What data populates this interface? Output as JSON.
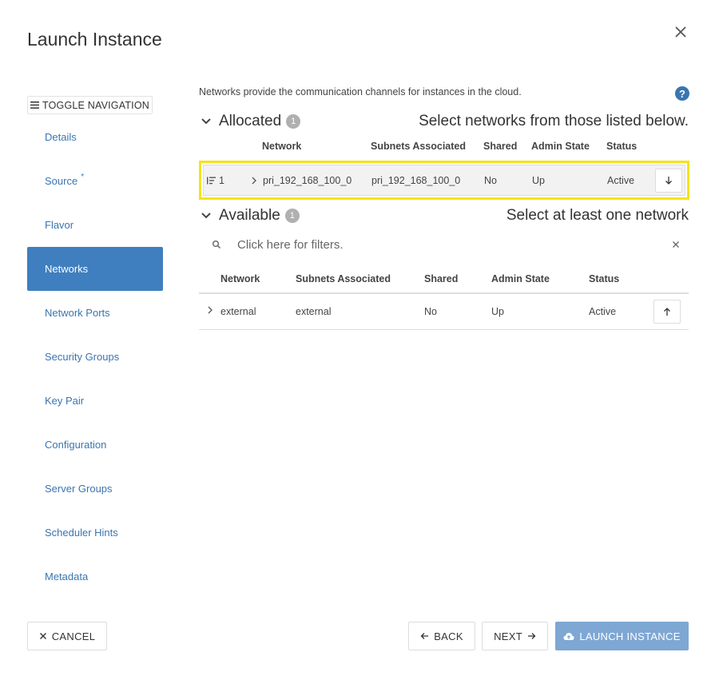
{
  "dialog": {
    "title": "Launch Instance",
    "close_icon": "close-icon"
  },
  "sidebar": {
    "toggle_label": "TOGGLE NAVIGATION",
    "items": [
      {
        "label": "Details",
        "active": false
      },
      {
        "label": "Source",
        "required_mark": "*",
        "active": false
      },
      {
        "label": "Flavor",
        "active": false
      },
      {
        "label": "Networks",
        "active": true
      },
      {
        "label": "Network Ports",
        "active": false
      },
      {
        "label": "Security Groups",
        "active": false
      },
      {
        "label": "Key Pair",
        "active": false
      },
      {
        "label": "Configuration",
        "active": false
      },
      {
        "label": "Server Groups",
        "active": false
      },
      {
        "label": "Scheduler Hints",
        "active": false
      },
      {
        "label": "Metadata",
        "active": false
      }
    ]
  },
  "main": {
    "description": "Networks provide the communication channels for instances in the cloud.",
    "help_label": "?",
    "allocated": {
      "title": "Allocated",
      "count": "1",
      "hint": "Select networks from those listed below.",
      "columns": [
        "Network",
        "Subnets Associated",
        "Shared",
        "Admin State",
        "Status"
      ],
      "rows": [
        {
          "order": "1",
          "network": "pri_192_168_100_0",
          "subnets": "pri_192_168_100_0",
          "shared": "No",
          "admin_state": "Up",
          "status": "Active"
        }
      ]
    },
    "available": {
      "title": "Available",
      "count": "1",
      "hint": "Select at least one network",
      "filter_placeholder": "Click here for filters.",
      "columns": [
        "Network",
        "Subnets Associated",
        "Shared",
        "Admin State",
        "Status"
      ],
      "rows": [
        {
          "network": "external",
          "subnets": "external",
          "shared": "No",
          "admin_state": "Up",
          "status": "Active"
        }
      ]
    }
  },
  "footer": {
    "cancel_label": "CANCEL",
    "back_label": "BACK",
    "next_label": "NEXT",
    "launch_label": "LAUNCH INSTANCE"
  },
  "colors": {
    "accent": "#3f7fbf",
    "link": "#3a75b0",
    "highlight": "#f5e31a",
    "primary_disabled": "#7ea7d4"
  }
}
